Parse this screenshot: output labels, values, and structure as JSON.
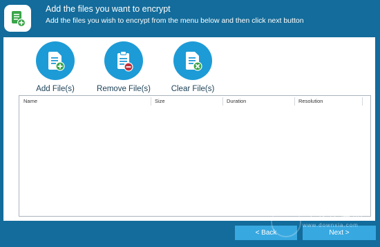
{
  "header": {
    "title": "Add the files you want to encrypt",
    "subtitle": "Add the files you wish to encrypt from the menu below and then click next button"
  },
  "toolbar": {
    "add_label": "Add File(s)",
    "remove_label": "Remove File(s)",
    "clear_label": "Clear File(s)"
  },
  "table": {
    "columns": [
      "Name",
      "Size",
      "Duration",
      "Resolution"
    ],
    "rows": []
  },
  "footer": {
    "back_label": "< Back",
    "next_label": "Next >"
  },
  "watermark": {
    "text": "当下软件园",
    "url": "www.downxia.com"
  },
  "colors": {
    "background": "#136c9b",
    "accent": "#1d9bd6",
    "button": "#38a8e0"
  }
}
